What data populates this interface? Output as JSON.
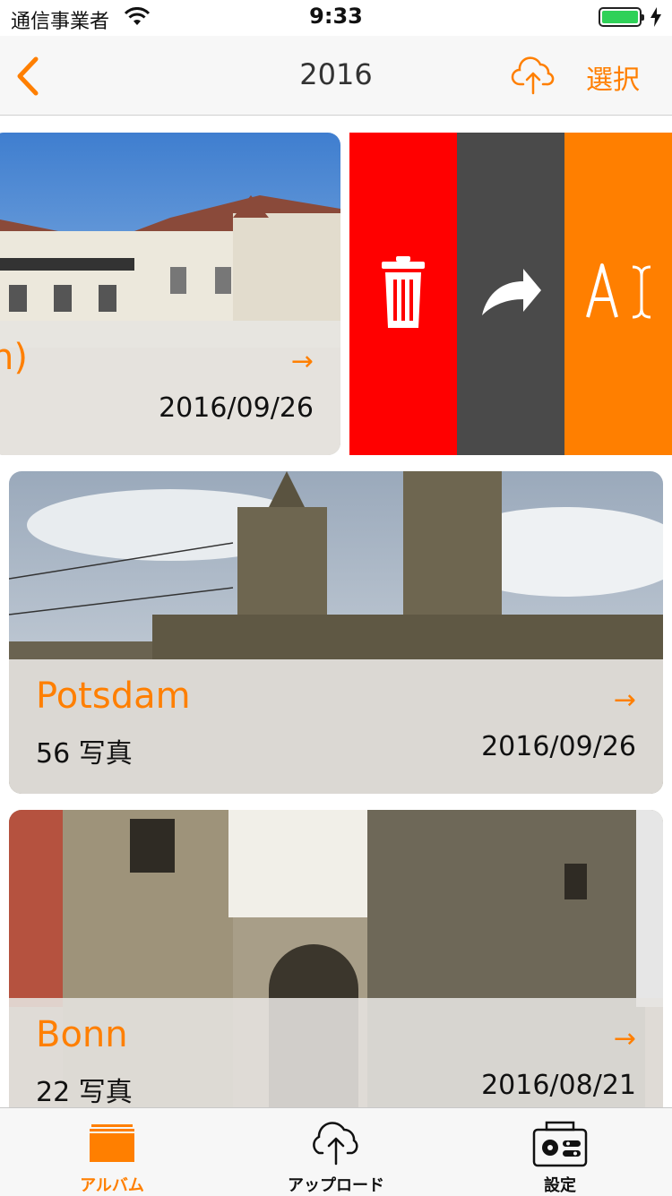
{
  "status_bar": {
    "carrier": "通信事業者",
    "time": "9:33",
    "battery_level": 1.0
  },
  "nav": {
    "title": "2016",
    "select_label": "選択",
    "icons": {
      "back": "chevron-left-icon",
      "upload": "cloud-upload-icon"
    }
  },
  "albums": [
    {
      "title": "n)",
      "count": "",
      "date": "2016/09/26",
      "arrow": "→"
    },
    {
      "title": "Potsdam",
      "count": "56 写真",
      "date": "2016/09/26",
      "arrow": "→"
    },
    {
      "title": "Bonn",
      "count": "22 写真",
      "date": "2016/08/21",
      "arrow": "→"
    }
  ],
  "swipe_actions": {
    "delete_icon": "trash-icon",
    "share_icon": "share-arrow-icon",
    "rename_icon": "rename-text-icon"
  },
  "tabs": [
    {
      "label": "アルバム",
      "icon": "album-stack-icon",
      "active": true
    },
    {
      "label": "アップロード",
      "icon": "cloud-upload-icon",
      "active": false
    },
    {
      "label": "設定",
      "icon": "settings-toolbox-icon",
      "active": false
    }
  ],
  "colors": {
    "accent": "#ff7f00",
    "delete": "#ff0000",
    "share": "#4a4a4a",
    "battery": "#2fd158"
  }
}
